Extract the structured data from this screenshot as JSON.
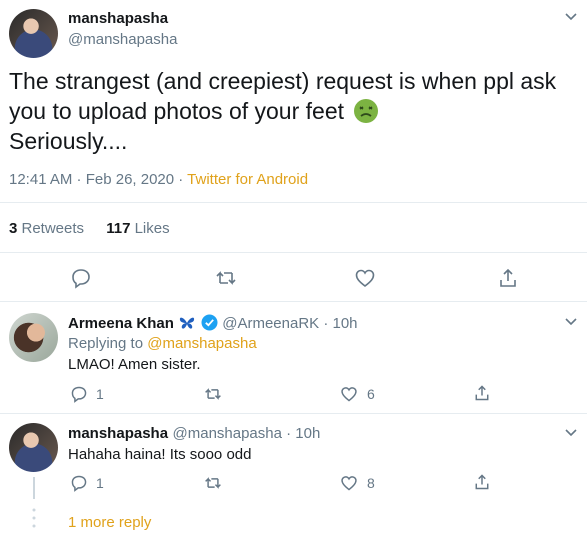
{
  "main_tweet": {
    "name": "manshapasha",
    "handle": "@manshapasha",
    "text_line1": "The strangest (and creepiest) request is when ppl ask",
    "text_line2": "you to upload photos of your feet",
    "text_line3": "Seriously....",
    "time": "12:41 AM · Feb 26, 2020 · ",
    "source": "Twitter for Android",
    "retweets_count": "3",
    "retweets_label": " Retweets",
    "likes_count": "117",
    "likes_label": " Likes"
  },
  "replies": [
    {
      "name": "Armeena Khan",
      "handle": "@ArmeenaRK · 10h",
      "replying_prefix": "Replying to ",
      "replying_to": "@manshapasha",
      "text": "LMAO! Amen sister.",
      "reply_count": "1",
      "like_count": "6"
    },
    {
      "name": "manshapasha",
      "handle": "@manshapasha · 10h",
      "text": "Hahaha haina! Its sooo odd",
      "reply_count": "1",
      "like_count": "8"
    }
  ],
  "more_replies": "1 more reply",
  "colors": {
    "accent": "#e0a21b",
    "muted": "#657786",
    "verified": "#1da1f2"
  }
}
